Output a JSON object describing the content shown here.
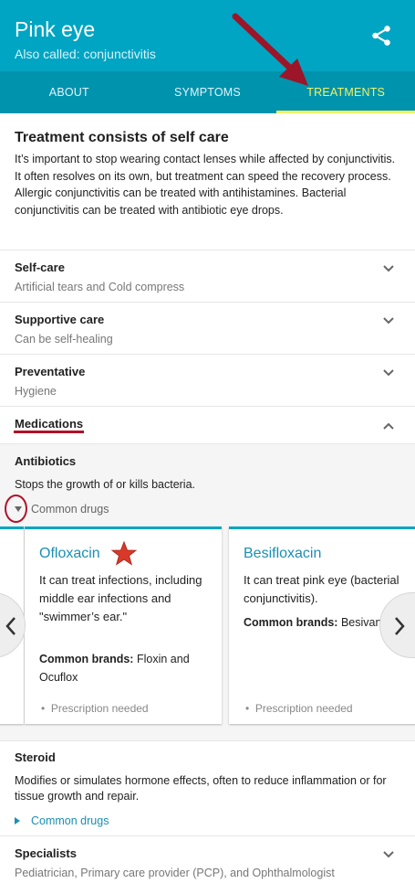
{
  "header": {
    "title": "Pink eye",
    "subtitle": "Also called: conjunctivitis",
    "share_icon": "share-icon",
    "bg_color": "#00a5c3"
  },
  "tabs": [
    {
      "label": "ABOUT",
      "active": false
    },
    {
      "label": "SYMPTOMS",
      "active": false
    },
    {
      "label": "TREATMENTS",
      "active": true
    }
  ],
  "intro": {
    "heading": "Treatment consists of self care",
    "text": "It’s important to stop wearing contact lenses while affected by conjunctivitis. It often resolves on its own, but treatment can speed the recovery process. Allergic conjunctivitis can be treated with antihistamines. Bacterial conjunctivitis can be treated with antibiotic eye drops."
  },
  "sections": [
    {
      "title": "Self-care",
      "subtitle": "Artificial tears and Cold compress",
      "expanded": false
    },
    {
      "title": "Supportive care",
      "subtitle": "Can be self-healing",
      "expanded": false
    },
    {
      "title": "Preventative",
      "subtitle": "Hygiene",
      "expanded": false
    },
    {
      "title": "Medications",
      "expanded": true
    }
  ],
  "medications": {
    "antibiotics": {
      "title": "Antibiotics",
      "description": "Stops the growth of or kills bacteria.",
      "common_drugs_label": "Common drugs"
    },
    "cards": [
      {
        "name": "Ofloxacin",
        "description": "It can treat infections, including middle ear infections and \"swimmer’s ear.\"",
        "brands_label": "Common brands:",
        "brands": "Floxin and Ocuflox",
        "rx": "Prescription needed"
      },
      {
        "name": "Besifloxacin",
        "description": "It can treat pink eye (bacterial conjunctivitis).",
        "brands_label": "Common brands:",
        "brands": "Besivance",
        "rx": "Prescription needed"
      }
    ],
    "steroid": {
      "title": "Steroid",
      "description": "Modifies or simulates hormone effects, often to reduce inflammation or for tissue growth and repair.",
      "common_drugs_label": "Common drugs"
    }
  },
  "specialists": {
    "title": "Specialists",
    "subtitle": "Pediatrician, Primary care provider (PCP), and Ophthalmologist"
  },
  "colors": {
    "accent": "#00a5c3",
    "tab_active": "#f5f163",
    "annotation": "#b0122a",
    "link": "#1a8fb3"
  }
}
